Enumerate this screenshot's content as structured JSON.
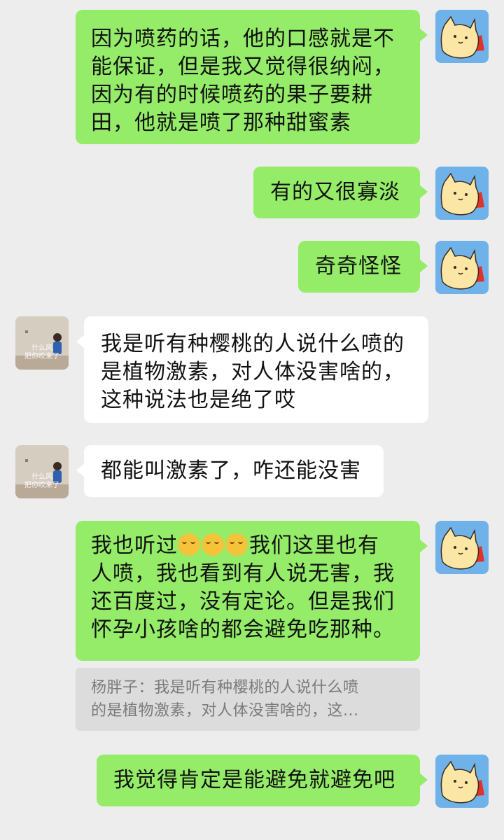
{
  "messages": [
    {
      "side": "me",
      "text": "因为喷药的话，他的口感就是不\n能保证，但是我又觉得很纳闷，\n因为有的时候喷药的果子要耕\n田，他就是喷了那种甜蜜素",
      "avatar": "cat-avatar"
    },
    {
      "side": "me",
      "text": "有的又很寡淡",
      "avatar": "cat-avatar"
    },
    {
      "side": "me",
      "text": "奇奇怪怪",
      "avatar": "cat-avatar"
    },
    {
      "side": "other",
      "text": "我是听有种樱桃的人说什么喷的\n是植物激素，对人体没害啥的，\n这种说法也是绝了哎",
      "avatar": "girl-avatar",
      "avatar_caption": "什么风\n把你吹来了"
    },
    {
      "side": "other",
      "text": "都能叫激素了，咋还能没害",
      "avatar": "girl-avatar",
      "avatar_caption": "什么风\n把你吹来了"
    },
    {
      "side": "me",
      "text_before_emoji": "我也听过",
      "emoji_count": 3,
      "emoji_name": "face-with-tears-of-joy",
      "text_after_emoji": "我们这里也有\n人喷，我也看到有人说无害，我\n还百度过，没有定论。但是我们\n怀孕小孩啥的都会避免吃那种。",
      "avatar": "cat-avatar"
    },
    {
      "side": "me",
      "text": "我觉得肯定是能避免就避免吧",
      "avatar": "cat-avatar"
    }
  ],
  "quote": {
    "sender": "杨胖子",
    "text": "杨胖子：我是听有种樱桃的人说什么喷\n的是植物激素，对人体没害啥的，这..."
  },
  "colors": {
    "background": "#ededed",
    "my_bubble": "#95ec69",
    "other_bubble": "#ffffff",
    "quote_bg": "#dcdcdc"
  }
}
